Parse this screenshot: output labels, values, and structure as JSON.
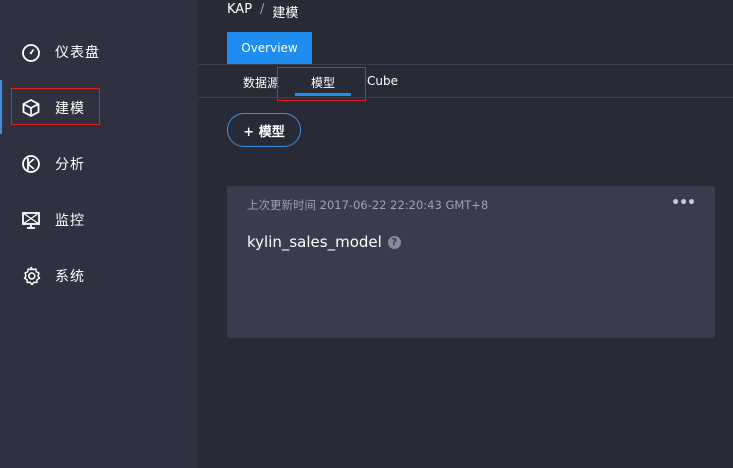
{
  "sidebar": {
    "items": [
      {
        "label": "仪表盘",
        "icon": "dashboard-icon"
      },
      {
        "label": "建模",
        "icon": "cube-icon"
      },
      {
        "label": "分析",
        "icon": "analysis-icon"
      },
      {
        "label": "监控",
        "icon": "monitor-icon"
      },
      {
        "label": "系统",
        "icon": "gear-icon"
      }
    ],
    "active_index": 1
  },
  "breadcrumb": {
    "root": "KAP",
    "separator": "/",
    "current": "建模"
  },
  "tabs": {
    "overview": "Overview"
  },
  "subtabs": [
    "数据源",
    "模型",
    "Cube"
  ],
  "subtab_active_index": 1,
  "toolbar": {
    "add_model_label": "+ 模型"
  },
  "model_card": {
    "updated_text": "上次更新时间 2017-06-22 22:20:43 GMT+8",
    "more_label": "•••",
    "name": "kylin_sales_model",
    "help_icon_label": "?"
  },
  "colors": {
    "accent": "#1f8cf0",
    "highlight_box": "#e02020",
    "sidebar_bg": "#2f3140",
    "main_bg": "#282a36",
    "card_bg": "#3a3c4e"
  }
}
